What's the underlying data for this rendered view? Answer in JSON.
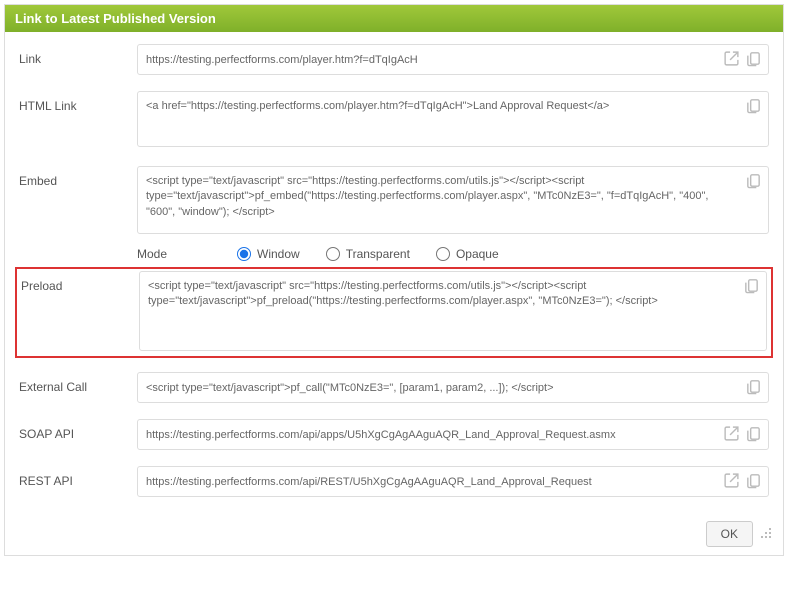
{
  "header": {
    "title": "Link to Latest Published Version"
  },
  "fields": {
    "link": {
      "label": "Link",
      "value": "https://testing.perfectforms.com/player.htm?f=dTqIgAcH"
    },
    "html_link": {
      "label": "HTML Link",
      "value": "<a href=\"https://testing.perfectforms.com/player.htm?f=dTqIgAcH\">Land Approval Request</a>"
    },
    "embed": {
      "label": "Embed",
      "value": "<script type=\"text/javascript\" src=\"https://testing.perfectforms.com/utils.js\"></script><script type=\"text/javascript\">pf_embed(\"https://testing.perfectforms.com/player.aspx\", \"MTc0NzE3=\", \"f=dTqIgAcH\", \"400\", \"600\", \"window\"); </script>",
      "mode_label": "Mode",
      "modes": {
        "window": "Window",
        "transparent": "Transparent",
        "opaque": "Opaque"
      },
      "mode_selected": "window"
    },
    "preload": {
      "label": "Preload",
      "value": "<script type=\"text/javascript\" src=\"https://testing.perfectforms.com/utils.js\"></script><script type=\"text/javascript\">pf_preload(\"https://testing.perfectforms.com/player.aspx\", \"MTc0NzE3=\"); </script>"
    },
    "external_call": {
      "label": "External Call",
      "value": "<script type=\"text/javascript\">pf_call(\"MTc0NzE3=\", [param1, param2, ...]); </script>"
    },
    "soap_api": {
      "label": "SOAP API",
      "value": "https://testing.perfectforms.com/api/apps/U5hXgCgAgAAguAQR_Land_Approval_Request.asmx"
    },
    "rest_api": {
      "label": "REST API",
      "value": "https://testing.perfectforms.com/api/REST/U5hXgCgAgAAguAQR_Land_Approval_Request"
    }
  },
  "footer": {
    "ok": "OK"
  }
}
